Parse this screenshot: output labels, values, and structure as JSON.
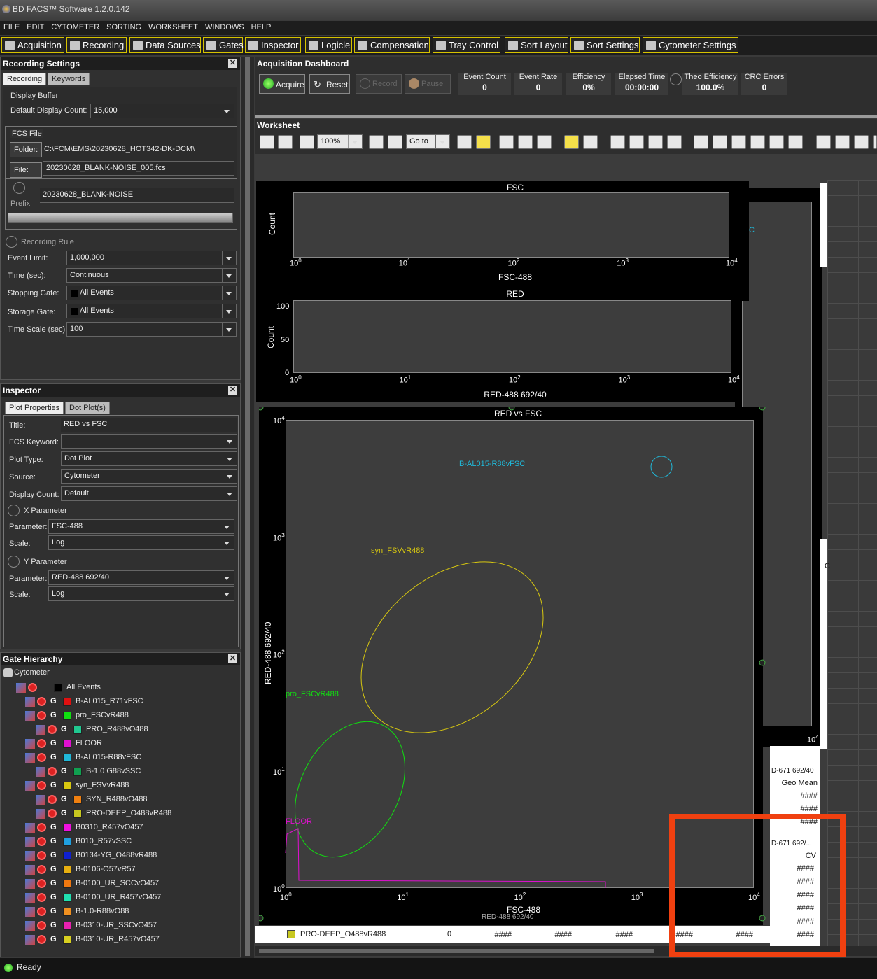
{
  "app": {
    "title": "BD FACS™ Software 1.2.0.142"
  },
  "menu": [
    "FILE",
    "EDIT",
    "CYTOMETER",
    "SORTING",
    "WORKSHEET",
    "WINDOWS",
    "HELP"
  ],
  "toolbar": [
    "Acquisition",
    "Recording",
    "Data Sources",
    "Gates",
    "Inspector",
    "Logicle",
    "Compensation",
    "Tray Control",
    "Sort Layout",
    "Sort Settings",
    "Cytometer Settings"
  ],
  "recording": {
    "header": "Recording Settings",
    "tabs": [
      "Recording",
      "Keywords"
    ],
    "display_buffer_label": "Display Buffer",
    "default_display_count_label": "Default Display Count:",
    "default_display_count": "15,000",
    "fcs_file_label": "FCS File",
    "folder_btn": "Folder:",
    "folder": "C:\\FCM\\EMS\\20230628_HOT342-DK-DCM\\",
    "file_btn": "File:",
    "file": "20230628_BLANK-NOISE_005.fcs",
    "prefix_label": "Prefix",
    "prefix": "20230628_BLANK-NOISE",
    "rule_label": "Recording Rule",
    "event_limit_label": "Event Limit:",
    "event_limit": "1,000,000",
    "time_label": "Time (sec):",
    "time": "Continuous",
    "stopping_gate_label": "Stopping Gate:",
    "stopping_gate": "All Events",
    "storage_gate_label": "Storage Gate:",
    "storage_gate": "All Events",
    "time_scale_label": "Time Scale (sec):",
    "time_scale": "100"
  },
  "inspector": {
    "header": "Inspector",
    "tabs": [
      "Plot Properties",
      "Dot Plot(s)"
    ],
    "title_label": "Title:",
    "title": "RED vs FSC",
    "fcs_keyword_label": "FCS Keyword:",
    "fcs_keyword": "",
    "plot_type_label": "Plot Type:",
    "plot_type": "Dot Plot",
    "source_label": "Source:",
    "source": "Cytometer",
    "display_count_label": "Display Count:",
    "display_count": "Default",
    "x_param_header": "X Parameter",
    "x_param_label": "Parameter:",
    "x_param": "FSC-488",
    "x_scale_label": "Scale:",
    "x_scale": "Log",
    "y_param_header": "Y Parameter",
    "y_param_label": "Parameter:",
    "y_param": "RED-488 692/40",
    "y_scale_label": "Scale:",
    "y_scale": "Log"
  },
  "gates": {
    "header": "Gate Hierarchy",
    "root": "Cytometer",
    "items": [
      {
        "name": "All Events",
        "color": "#000000",
        "g": ""
      },
      {
        "name": "B-AL015_R71vFSC",
        "color": "#e01010",
        "g": "G"
      },
      {
        "name": "pro_FSCvR488",
        "color": "#10e010",
        "g": "G"
      },
      {
        "name": "PRO_R488vO488",
        "color": "#20c890",
        "g": "G"
      },
      {
        "name": "FLOOR",
        "color": "#e010d0",
        "g": "G"
      },
      {
        "name": "B-AL015-R88vFSC",
        "color": "#20b8d8",
        "g": "G"
      },
      {
        "name": "B-1.0 G88vSSC",
        "color": "#10a050",
        "g": "G"
      },
      {
        "name": "syn_FSVvR488",
        "color": "#d8c810",
        "g": "G"
      },
      {
        "name": "SYN_R488vO488",
        "color": "#f08010",
        "g": "G"
      },
      {
        "name": "PRO-DEEP_O488vR488",
        "color": "#c8c820",
        "g": "G"
      },
      {
        "name": "B0310_R457vO457",
        "color": "#f010e0",
        "g": "G"
      },
      {
        "name": "B010_R57vSSC",
        "color": "#20a0e0",
        "g": "G"
      },
      {
        "name": "B0134-YG_O488vR488",
        "color": "#1020d0",
        "g": "G"
      },
      {
        "name": "B-0106-O57vR57",
        "color": "#e8b010",
        "g": "G"
      },
      {
        "name": "B-0100_UR_SCCvO457",
        "color": "#f07810",
        "g": "G"
      },
      {
        "name": "B-0100_UR_R457vO457",
        "color": "#20e0b0",
        "g": "G"
      },
      {
        "name": "B-1.0-R88vO88",
        "color": "#f09020",
        "g": "G"
      },
      {
        "name": "B-0310-UR_SSCvO457",
        "color": "#e820b0",
        "g": "G"
      },
      {
        "name": "B-0310-UR_R457vO457",
        "color": "#d8d020",
        "g": "G"
      }
    ]
  },
  "dashboard": {
    "header": "Acquisition Dashboard",
    "acquire": "Acquire",
    "reset": "Reset",
    "record": "Record",
    "pause": "Pause",
    "stats": [
      {
        "label": "Event Count",
        "value": "0"
      },
      {
        "label": "Event Rate",
        "value": "0"
      },
      {
        "label": "Efficiency",
        "value": "0%"
      },
      {
        "label": "Elapsed Time",
        "value": "00:00:00"
      },
      {
        "label": "Theo Efficiency",
        "value": "100.0%"
      },
      {
        "label": "CRC Errors",
        "value": "0"
      }
    ]
  },
  "worksheet": {
    "header": "Worksheet",
    "zoom": "100%",
    "goto": "Go to"
  },
  "plots": {
    "fsc_hist": {
      "title": "FSC",
      "ylabel": "Count",
      "xlabel": "FSC-488",
      "xticks": [
        "10",
        "10",
        "10",
        "10",
        "10"
      ],
      "xexp": [
        "0",
        "1",
        "2",
        "3",
        "4"
      ]
    },
    "red_hist": {
      "title": "RED",
      "ylabel": "Count",
      "xlabel": "RED-488 692/40",
      "yticks": [
        "100",
        "50",
        "0"
      ],
      "xticks": [
        "10",
        "10",
        "10",
        "10",
        "10"
      ],
      "xexp": [
        "0",
        "1",
        "2",
        "3",
        "4"
      ]
    },
    "dot": {
      "title": "RED vs FSC",
      "ylabel": "RED-488 692/40",
      "xlabel": "FSC-488",
      "tick_base": "10",
      "exps": [
        "0",
        "1",
        "2",
        "3",
        "4"
      ],
      "gates": [
        {
          "label": "B-AL015-R88vFSC",
          "color": "#20b8d8"
        },
        {
          "label": "syn_FSVvR488",
          "color": "#d8c810"
        },
        {
          "label": "pro_FSCvR488",
          "color": "#10e010"
        },
        {
          "label": "FLOOR",
          "color": "#e010d0"
        }
      ]
    }
  },
  "stats_table": {
    "h1": "D-671 692/40",
    "h2": "Geo Mean",
    "h3": "D-671 692/...",
    "h4": "CV",
    "hash": "####",
    "last_row": {
      "name": "PRO-DEEP_O488vR488",
      "count": "0"
    },
    "behind_label": "RED-488 692/40"
  },
  "peek": {
    "c": "C",
    "c2": "C",
    "tick": "10",
    "tick_exp": "4"
  },
  "status": {
    "text": "Ready"
  },
  "highlight_color": "#f04010"
}
